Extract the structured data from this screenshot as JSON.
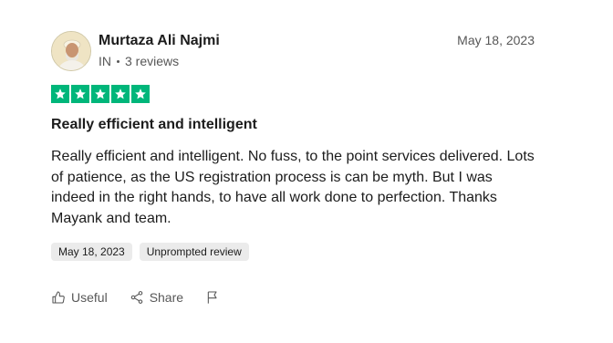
{
  "review": {
    "consumer": {
      "name": "Murtaza Ali Najmi",
      "country": "IN",
      "review_count": "3 reviews"
    },
    "date": "May 18, 2023",
    "rating": 5,
    "title": "Really efficient and intelligent",
    "body": "Really efficient and intelligent. No fuss, to the point services delivered. Lots of patience, as the US registration process is can be myth. But I was indeed in the right hands, to have all work done to perfection. Thanks Mayank and team.",
    "tags": [
      "May 18, 2023",
      "Unprompted review"
    ],
    "actions": {
      "useful": "Useful",
      "share": "Share"
    }
  },
  "colors": {
    "star_bg": "#00b67a",
    "text_primary": "#1c1c1c",
    "text_secondary": "#575757",
    "tag_bg": "#ebebeb"
  },
  "icons": {
    "useful": "thumbs-up-icon",
    "share": "share-icon",
    "flag": "flag-icon",
    "star": "star-icon"
  }
}
